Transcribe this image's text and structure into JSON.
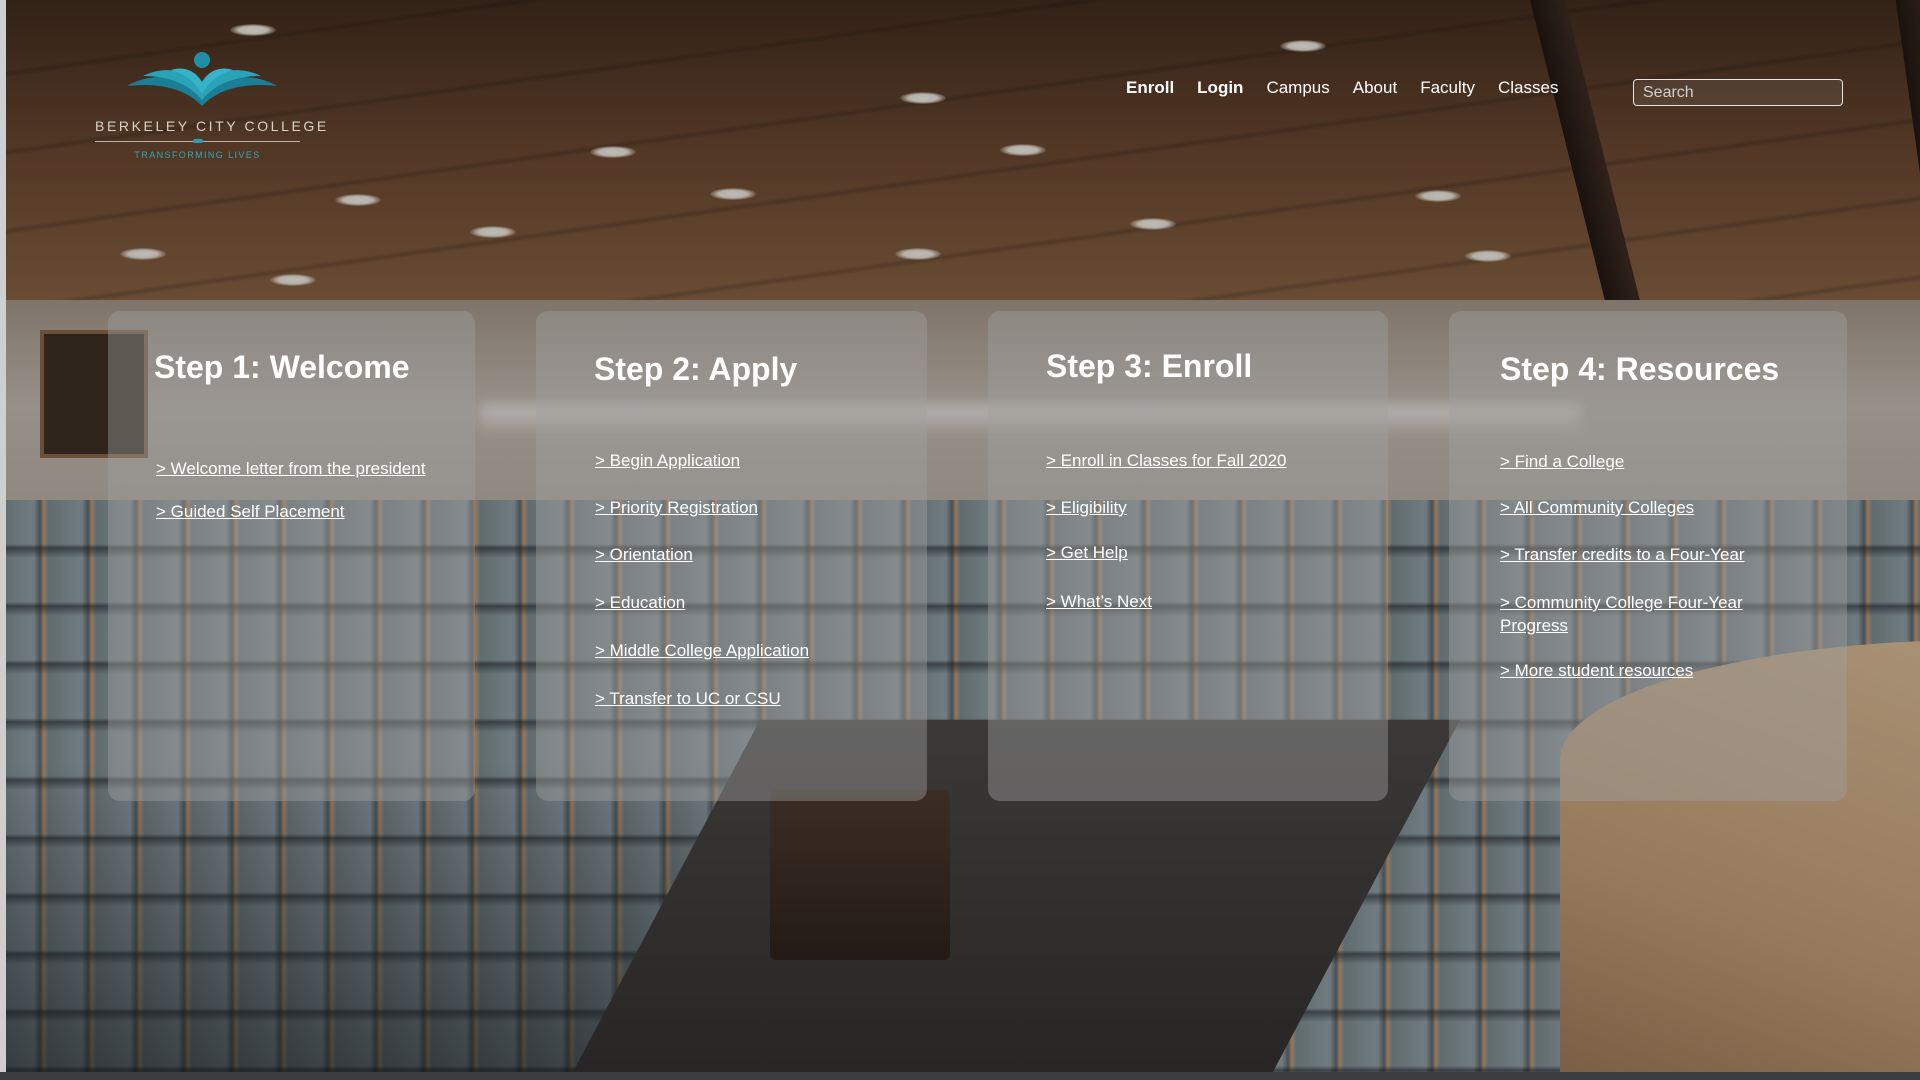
{
  "logo": {
    "name": "BERKELEY CITY COLLEGE",
    "tagline": "TRANSFORMING LIVES"
  },
  "nav": {
    "items": [
      {
        "label": "Enroll",
        "bold": true
      },
      {
        "label": "Login",
        "bold": true
      },
      {
        "label": "Campus",
        "bold": false
      },
      {
        "label": "About",
        "bold": false
      },
      {
        "label": "Faculty",
        "bold": false
      },
      {
        "label": "Classes",
        "bold": false
      }
    ],
    "search_placeholder": "Search"
  },
  "steps": [
    {
      "title": "Step 1: Welcome",
      "links": [
        "> Welcome letter from the president",
        "> Guided Self Placement"
      ]
    },
    {
      "title": "Step 2: Apply",
      "links": [
        "> Begin Application",
        "> Priority Registration",
        "> Orientation",
        "> Education",
        "> Middle College Application",
        "> Transfer to UC or CSU"
      ]
    },
    {
      "title": "Step 3: Enroll",
      "links": [
        "> Enroll in Classes for Fall 2020",
        "> Eligibility",
        "> Get Help",
        "> What’s Next"
      ]
    },
    {
      "title": "Step 4: Resources",
      "links": [
        "> Find a College",
        "> All Community Colleges",
        "> Transfer credits to a Four-Year",
        "> Community College Four-Year Progress",
        "> More student resources"
      ]
    }
  ],
  "colors": {
    "brand_teal": "#1f8fa6",
    "card_overlay": "rgba(160,160,160,0.42)"
  }
}
